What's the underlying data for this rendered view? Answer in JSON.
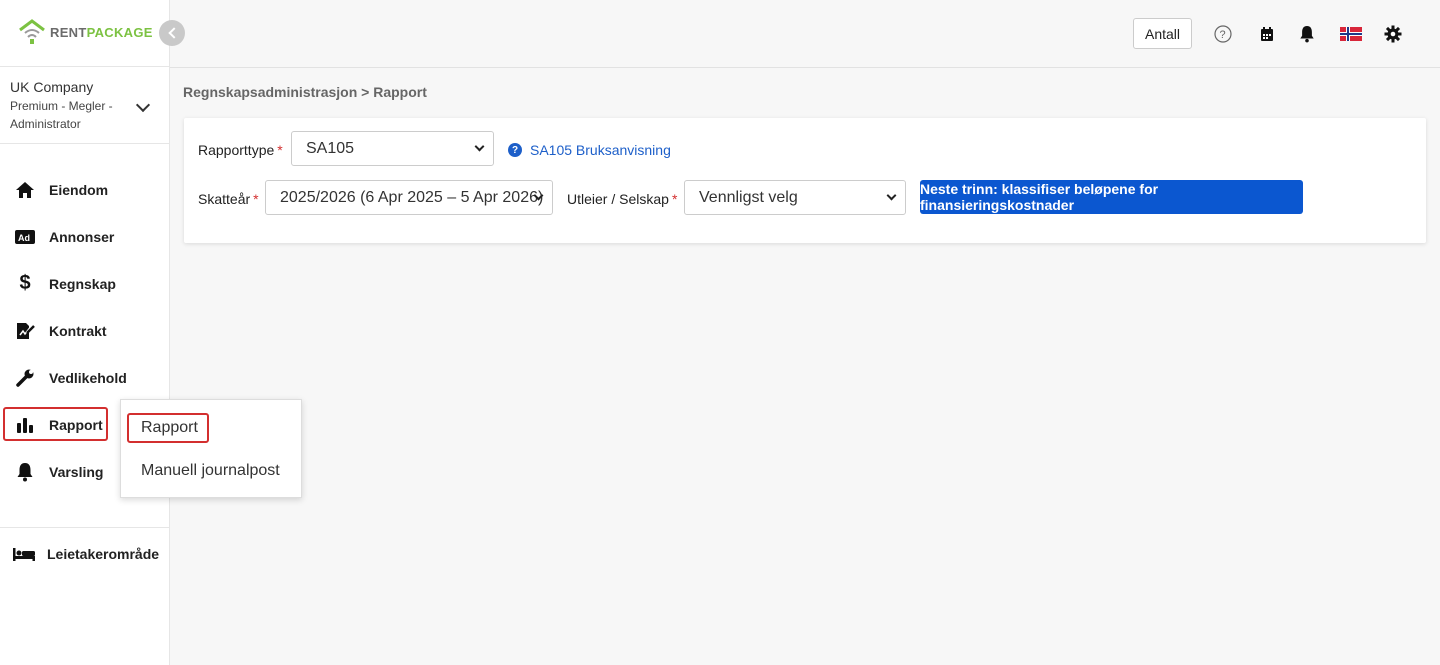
{
  "logo": {
    "part1": "RENT",
    "part2": "PACKAGE"
  },
  "company": {
    "name": "UK Company",
    "role": "Premium - Megler - Administrator"
  },
  "sidebar": {
    "items": [
      {
        "label": "Eiendom",
        "icon": "home-icon"
      },
      {
        "label": "Annonser",
        "icon": "ad-icon"
      },
      {
        "label": "Regnskap",
        "icon": "dollar-icon"
      },
      {
        "label": "Kontrakt",
        "icon": "contract-icon"
      },
      {
        "label": "Vedlikehold",
        "icon": "wrench-icon"
      },
      {
        "label": "Rapport",
        "icon": "bar-chart-icon"
      },
      {
        "label": "Varsling",
        "icon": "bell-icon"
      }
    ],
    "bottom": {
      "label": "Leietakerområde",
      "icon": "bed-icon"
    }
  },
  "submenu": {
    "items": [
      "Rapport",
      "Manuell journalpost"
    ]
  },
  "header": {
    "antall": "Antall"
  },
  "breadcrumb": "Regnskapsadministrasjon > Rapport",
  "form": {
    "report_type_label": "Rapporttype",
    "report_type_value": "SA105",
    "help_link": "SA105 Bruksanvisning",
    "tax_year_label": "Skatteår",
    "tax_year_value": "2025/2026 (6 Apr 2025 – 5 Apr 2026)",
    "landlord_label": "Utleier / Selskap",
    "landlord_value": "Vennligst velg",
    "next_button": "Neste trinn: klassifiser beløpene for finansieringskostnader"
  },
  "colors": {
    "accent": "#0b57d0",
    "brand_green": "#7cc242",
    "highlight": "#d32f2f"
  }
}
